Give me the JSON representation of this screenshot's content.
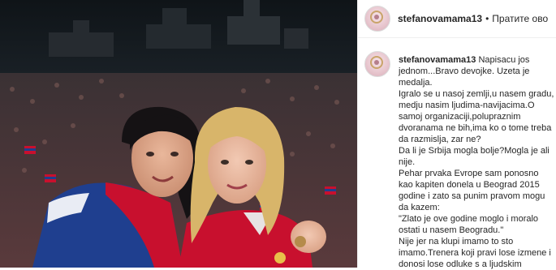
{
  "post": {
    "username": "stefanovamama13",
    "separator": "•",
    "follow_label": "Пратите ово"
  },
  "caption": {
    "username": "stefanovamama13",
    "lines": [
      "Napisacu jos jednom...Bravo devojke. Uzeta je medalja.",
      "Igralo se u nasoj zemlji,u nasem gradu, medju nasim ljudima-navijacima.O samoj organizaciji,polupraznim dvoranama ne bih,ima ko o tome treba da razmislja, zar ne?",
      "Da li je Srbija mogla bolje?Mogla je ali nije.",
      "Pehar prvaka Evrope sam ponosno kao kapiten donela u Beograd 2015 godine i zato sa punim pravom mogu da kazem:",
      "\"Zlato je ove godine moglo i moralo ostati u nasem Beogradu.\"",
      "Nije jer na klupi imamo to sto imamo.Trenera koji pravi lose izmene i donosi lose odluke s a ljudskim"
    ]
  },
  "icons": {
    "avatar": "profile-photo-icon"
  },
  "colors": {
    "text": "#262626",
    "border": "#efefef",
    "shirt_red": "#c8102e",
    "flag_blue": "#1f3f8f"
  }
}
